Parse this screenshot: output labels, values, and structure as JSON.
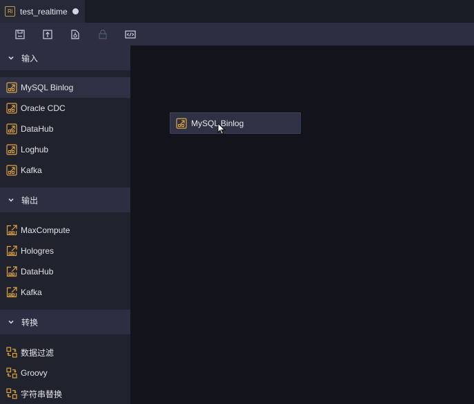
{
  "tab": {
    "badge": "Ri",
    "title": "test_realtime"
  },
  "toolbar": {
    "buttons": [
      {
        "icon": "save-icon"
      },
      {
        "icon": "upload-icon"
      },
      {
        "icon": "run-icon"
      },
      {
        "icon": "lock-icon",
        "disabled": true
      },
      {
        "icon": "code-icon"
      }
    ]
  },
  "sidebar": {
    "input": {
      "title": "输入",
      "items": [
        "MySQL Binlog",
        "Oracle CDC",
        "DataHub",
        "Loghub",
        "Kafka"
      ]
    },
    "output": {
      "title": "输出",
      "items": [
        "MaxCompute",
        "Hologres",
        "DataHub",
        "Kafka"
      ]
    },
    "transform": {
      "title": "转换",
      "items": [
        "数据过滤",
        "Groovy",
        "字符串替换"
      ]
    }
  },
  "canvas": {
    "drag_node_label": "MySQL Binlog"
  },
  "colors": {
    "accent": "#e0a63c",
    "sidebar": "#20222e",
    "canvas": "#12131b"
  }
}
